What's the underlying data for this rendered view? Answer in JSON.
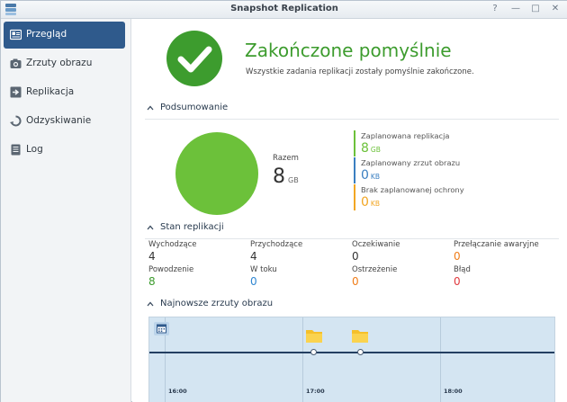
{
  "window": {
    "title": "Snapshot Replication",
    "controls": [
      "?",
      "—",
      "□",
      "✕"
    ]
  },
  "sidebar": {
    "items": [
      {
        "label": "Przegląd",
        "icon": "overview-icon",
        "active": true
      },
      {
        "label": "Zrzuty obrazu",
        "icon": "camera-icon",
        "active": false
      },
      {
        "label": "Replikacja",
        "icon": "replication-icon",
        "active": false
      },
      {
        "label": "Odzyskiwanie",
        "icon": "recovery-icon",
        "active": false
      },
      {
        "label": "Log",
        "icon": "log-icon",
        "active": false
      }
    ]
  },
  "status": {
    "title": "Zakończone pomyślnie",
    "subtitle": "Wszystkie zadania replikacji zostały pomyślnie zakończone.",
    "icon": "checkmark-icon",
    "color": "#3d9c2e"
  },
  "summary": {
    "heading": "Podsumowanie",
    "total_label": "Razem",
    "total_value": "8",
    "total_unit": "GB",
    "legend": [
      {
        "label": "Zaplanowana replikacja",
        "value": "8",
        "unit": "GB",
        "color": "#6cc13a"
      },
      {
        "label": "Zaplanowany zrzut obrazu",
        "value": "0",
        "unit": "KB",
        "color": "#3a7fc1"
      },
      {
        "label": "Brak zaplanowanej ochrony",
        "value": "0",
        "unit": "KB",
        "color": "#f2a623"
      }
    ]
  },
  "replication_status": {
    "heading": "Stan replikacji",
    "stats": [
      {
        "label": "Wychodzące",
        "value": "4",
        "color": "#333333"
      },
      {
        "label": "Przychodzące",
        "value": "4",
        "color": "#333333"
      },
      {
        "label": "Oczekiwanie",
        "value": "0",
        "color": "#333333"
      },
      {
        "label": "Przełączanie awaryjne",
        "value": "0",
        "color": "#f07d18"
      },
      {
        "label": "Powodzenie",
        "value": "8",
        "color": "#3d9c2e"
      },
      {
        "label": "W toku",
        "value": "0",
        "color": "#2f86d1"
      },
      {
        "label": "Ostrzeżenie",
        "value": "0",
        "color": "#f07d18"
      },
      {
        "label": "Błąd",
        "value": "0",
        "color": "#e0393e"
      }
    ]
  },
  "snapshots": {
    "heading": "Najnowsze zrzuty obrazu",
    "time_labels": [
      "16:00",
      "17:00",
      "18:00"
    ],
    "calendar_icon": "calendar-icon",
    "snapshot_icon": "folder-icon"
  }
}
